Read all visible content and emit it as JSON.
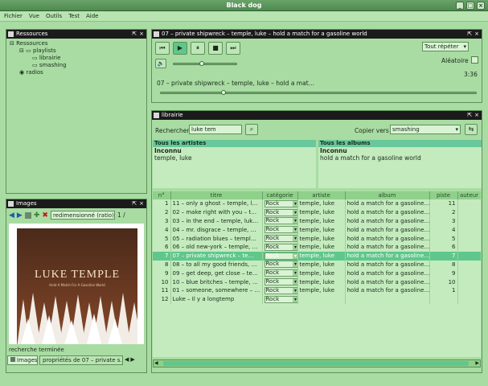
{
  "window": {
    "title": "Black dog"
  },
  "menu": [
    "Fichier",
    "Vue",
    "Outils",
    "Test",
    "Aide"
  ],
  "resources": {
    "title": "Ressources",
    "tree": {
      "root": "Ressources",
      "playlists": "playlists",
      "items": [
        "librairie",
        "smashing"
      ],
      "radios": "radios"
    }
  },
  "player": {
    "title": "07 – private shipwreck – temple, luke – hold a match for a gasoline world",
    "repeat": "Tout répéter",
    "shuffle": "Aléatoire",
    "time": "3:36",
    "now_playing": "07 – private shipwreck – temple, luke – hold a mat…",
    "volume": 0.45,
    "progress": 0.2
  },
  "library": {
    "title": "librairie",
    "search_label": "Rechercher",
    "search_value": "luke tem",
    "copy_label": "Copier vers",
    "copy_target": "smashing",
    "artists_header": "Tous les artistes",
    "artists": [
      "Inconnu",
      "temple, luke"
    ],
    "albums_header": "Tous les albums",
    "albums": [
      "Inconnu",
      "hold a match for a gasoline world"
    ],
    "columns": [
      "n°",
      "titre",
      "catégorie",
      "artiste",
      "album",
      "piste",
      "auteur"
    ],
    "rows": [
      {
        "n": "1",
        "titre": "11 – only a ghost – temple, l…",
        "cat": "Rock",
        "artiste": "temple, luke",
        "album": "hold a match for a gasoline…",
        "piste": "11"
      },
      {
        "n": "2",
        "titre": "02 – make right with you – t…",
        "cat": "Rock",
        "artiste": "temple, luke",
        "album": "hold a match for a gasoline…",
        "piste": "2"
      },
      {
        "n": "3",
        "titre": "03 – in the end – temple, luk…",
        "cat": "Rock",
        "artiste": "temple, luke",
        "album": "hold a match for a gasoline…",
        "piste": "3"
      },
      {
        "n": "4",
        "titre": "04 – mr. disgrace – temple, …",
        "cat": "Rock",
        "artiste": "temple, luke",
        "album": "hold a match for a gasoline…",
        "piste": "4"
      },
      {
        "n": "5",
        "titre": "05 – radiation blues – templ…",
        "cat": "Rock",
        "artiste": "temple, luke",
        "album": "hold a match for a gasoline…",
        "piste": "5"
      },
      {
        "n": "6",
        "titre": "06 – old new-york – temple, …",
        "cat": "Rock",
        "artiste": "temple, luke",
        "album": "hold a match for a gasoline…",
        "piste": "6"
      },
      {
        "n": "7",
        "titre": "07 – private shipwreck – te…",
        "cat": "Rock",
        "artiste": "temple, luke",
        "album": "hold a match for a gasoline…",
        "piste": "7",
        "selected": true
      },
      {
        "n": "8",
        "titre": "08 – to all my good friends, …",
        "cat": "Rock",
        "artiste": "temple, luke",
        "album": "hold a match for a gasoline…",
        "piste": "8"
      },
      {
        "n": "9",
        "titre": "09 – get deep, get close – te…",
        "cat": "Rock",
        "artiste": "temple, luke",
        "album": "hold a match for a gasoline…",
        "piste": "9"
      },
      {
        "n": "10",
        "titre": "10 – blue britches – temple, …",
        "cat": "Rock",
        "artiste": "temple, luke",
        "album": "hold a match for a gasoline…",
        "piste": "10"
      },
      {
        "n": "11",
        "titre": "01 – someone, somewhere – …",
        "cat": "Rock",
        "artiste": "temple, luke",
        "album": "hold a match for a gasoline…",
        "piste": "1"
      },
      {
        "n": "12",
        "titre": "Luke – Il y a longtemp",
        "cat": "Rock",
        "artiste": "",
        "album": "",
        "piste": ""
      }
    ]
  },
  "images": {
    "title": "Images",
    "resize": "redimensionné (ratio)",
    "page": "1 /",
    "cover_artist": "LUKE TEMPLE",
    "cover_subtitle": "Hold A Match For A Gasoline World",
    "status": "recherche terminée",
    "tabs": [
      "Images",
      "propriétés de 07 – private s…"
    ]
  }
}
